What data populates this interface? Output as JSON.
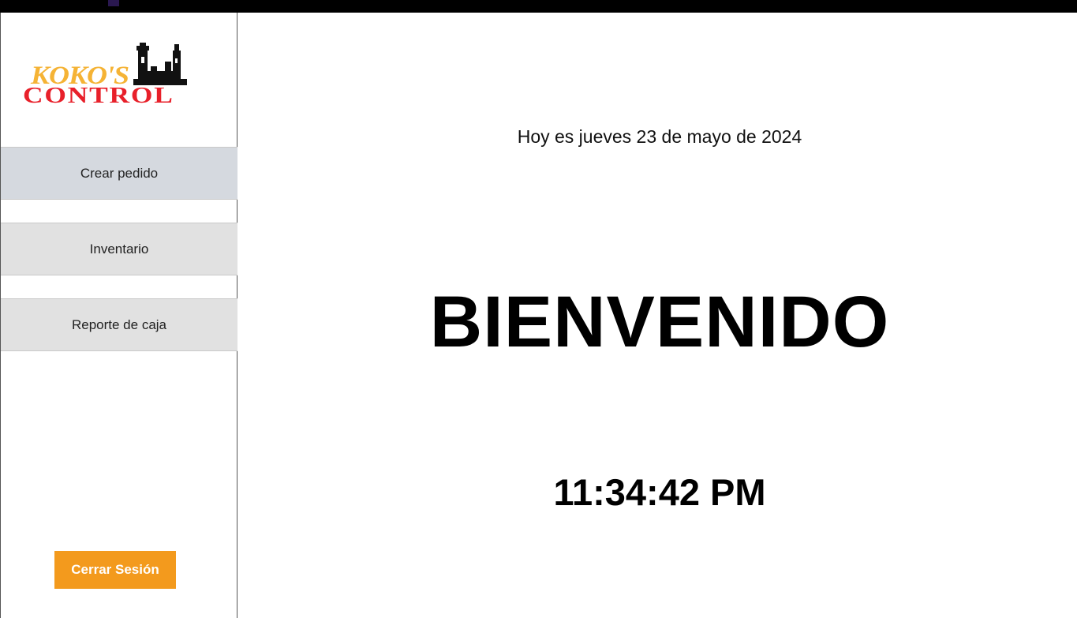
{
  "logo": {
    "line1": "KOKO'S",
    "line2": "CONTROL"
  },
  "sidebar": {
    "items": [
      {
        "label": "Crear pedido",
        "active": true
      },
      {
        "label": "Inventario",
        "active": false
      },
      {
        "label": "Reporte de caja",
        "active": false
      }
    ],
    "logout_label": "Cerrar Sesión"
  },
  "main": {
    "date_text": "Hoy es jueves 23 de mayo de 2024",
    "welcome": "BIENVENIDO",
    "clock": "11:34:42 PM"
  },
  "colors": {
    "logout_bg": "#f39a1d",
    "logo_yellow": "#f5b335",
    "logo_red": "#e8202a",
    "nav_bg": "#e1e1e1"
  }
}
